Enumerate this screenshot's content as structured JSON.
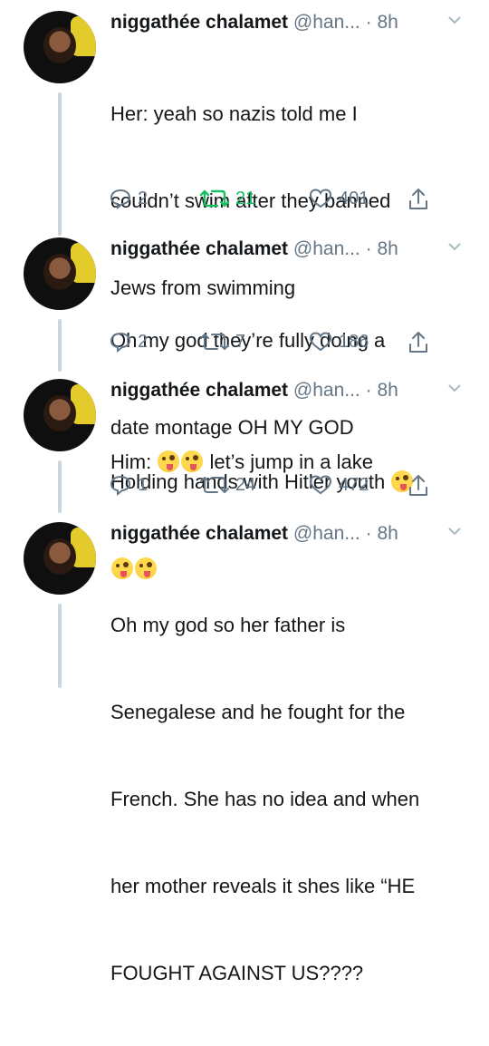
{
  "tweets": [
    {
      "name": "niggathée chalamet",
      "handle": "@han...",
      "time": "8h",
      "text_lines": [
        "Her: yeah so nazis told me I",
        "couldn’t swim after they banned",
        "Jews from swimming"
      ],
      "text_tail_before_emoji": "Him: ",
      "text_tail_after_emoji": " let’s jump in a lake",
      "replies": "2",
      "retweets": "21",
      "likes": "401",
      "retweeted": true
    },
    {
      "name": "niggathée chalamet",
      "handle": "@han...",
      "time": "8h",
      "text_lines": [
        "Oh my god they’re fully doing a",
        "date montage OH MY GOD"
      ],
      "replies": "2",
      "retweets": "7",
      "likes": "186",
      "retweeted": false
    },
    {
      "name": "niggathée chalamet",
      "handle": "@han...",
      "time": "8h",
      "text_lines": [
        "Holding hands with Hitler youth"
      ],
      "replies": "1",
      "retweets": "24",
      "likes": "472",
      "retweeted": false
    },
    {
      "name": "niggathée chalamet",
      "handle": "@han...",
      "time": "8h",
      "text_lines": [
        "Oh my god so her father is",
        "Senegalese and he fought for the",
        "French. She has no idea and when",
        "her mother reveals it shes like “HE",
        "FOUGHT AGAINST US????"
      ]
    }
  ],
  "separator": " · ",
  "icons": {
    "reply": "reply-icon",
    "retweet": "retweet-icon",
    "like": "heart-icon",
    "share": "share-icon",
    "caret": "chevron-down-icon",
    "emoji": "zany-face-emoji"
  },
  "colors": {
    "text": "#14171a",
    "muted": "#657786",
    "retweet_active": "#17bf63",
    "thread_line": "#ccd6dd"
  }
}
